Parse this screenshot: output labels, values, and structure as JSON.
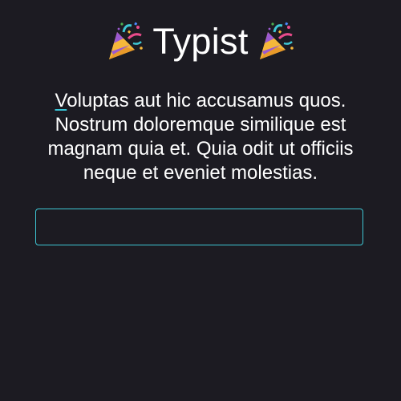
{
  "header": {
    "title": "Typist",
    "left_icon": "party-popper-icon",
    "right_icon": "party-popper-icon"
  },
  "prompt": {
    "first_char": "V",
    "rest": "oluptas aut hic accusamus quos. Nostrum doloremque similique est magnam quia et. Quia odit ut officiis neque et eveniet molestias."
  },
  "input": {
    "value": "",
    "placeholder": ""
  },
  "colors": {
    "background": "#1c1b22",
    "accent": "#3ec7d4",
    "text": "#ffffff"
  }
}
